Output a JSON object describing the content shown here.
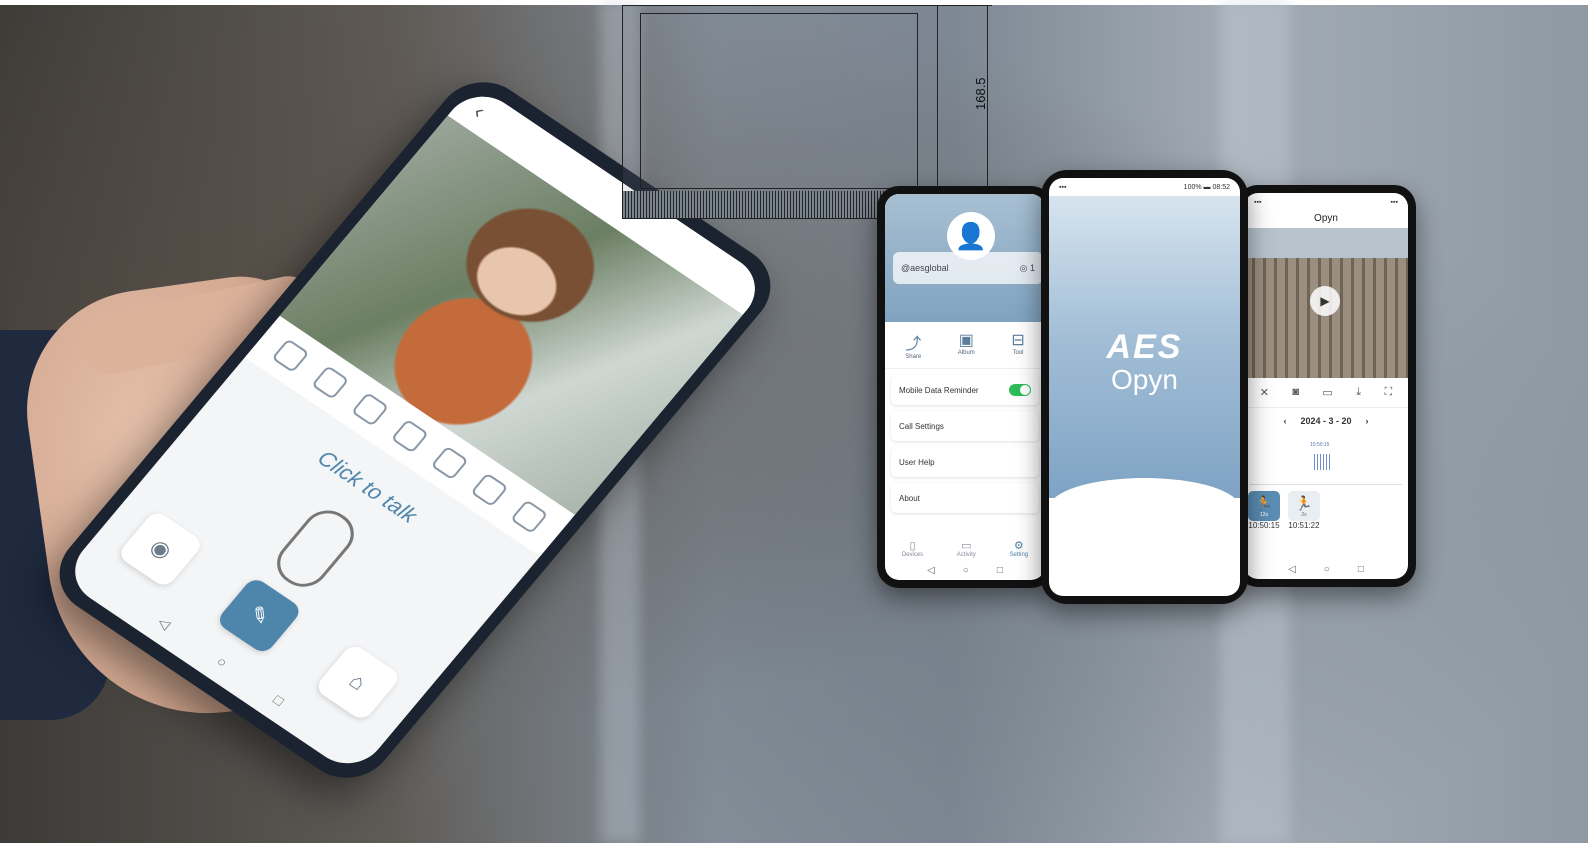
{
  "tilt_phone": {
    "back_icon": "chevron-left-icon",
    "click_to_talk": "Click to talk"
  },
  "dimension": {
    "label": "168.5"
  },
  "settings_phone": {
    "username": "@aesglobal",
    "device_count": "1",
    "tools": [
      {
        "label": "Share",
        "icon": "share-icon"
      },
      {
        "label": "Album",
        "icon": "image-icon"
      },
      {
        "label": "Tool",
        "icon": "toolbox-icon"
      }
    ],
    "rows": [
      "Mobile Data Reminder",
      "Call Settings",
      "User Help",
      "About"
    ],
    "tabs": [
      {
        "label": "Devices"
      },
      {
        "label": "Activity"
      },
      {
        "label": "Setting"
      }
    ]
  },
  "splash_phone": {
    "status_time": "08:52",
    "status_battery": "100%",
    "brand": "AES",
    "product": "Opyn"
  },
  "live_phone": {
    "title": "Opyn",
    "date": "2024 - 3 - 20",
    "tick": "10:50:15",
    "events": [
      {
        "time": "10:50:15",
        "duration": "12s"
      },
      {
        "time": "10:51:22",
        "duration": "2s"
      }
    ]
  },
  "colors": {
    "accent": "#4e86ab",
    "toggle_on": "#2ebd59"
  }
}
